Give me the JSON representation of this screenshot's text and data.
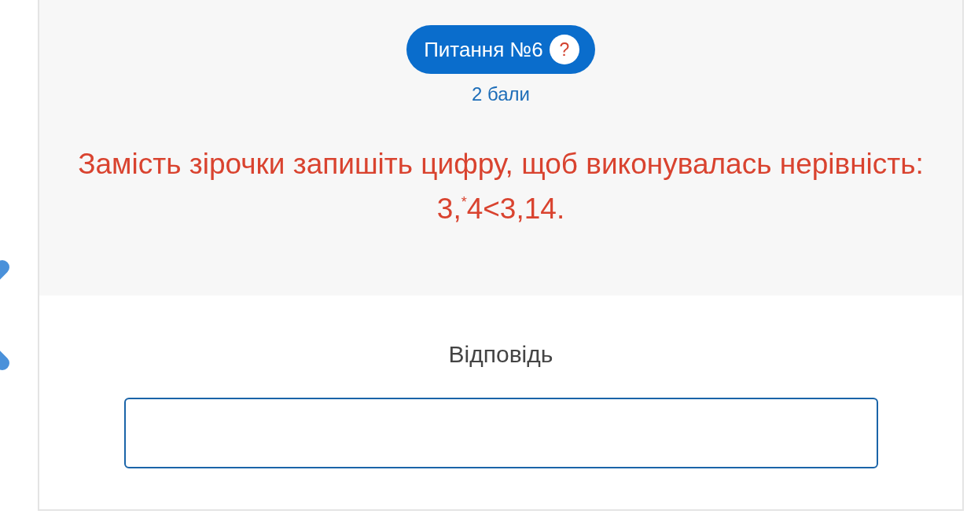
{
  "question_badge": {
    "label": "Питання №6",
    "help": "?"
  },
  "points": "2 бали",
  "question_text": "Замість зірочки запишіть цифру, щоб виконувалась нерівність: 3,$^{*}$4<3,14.",
  "answer": {
    "label": "Відповідь"
  }
}
